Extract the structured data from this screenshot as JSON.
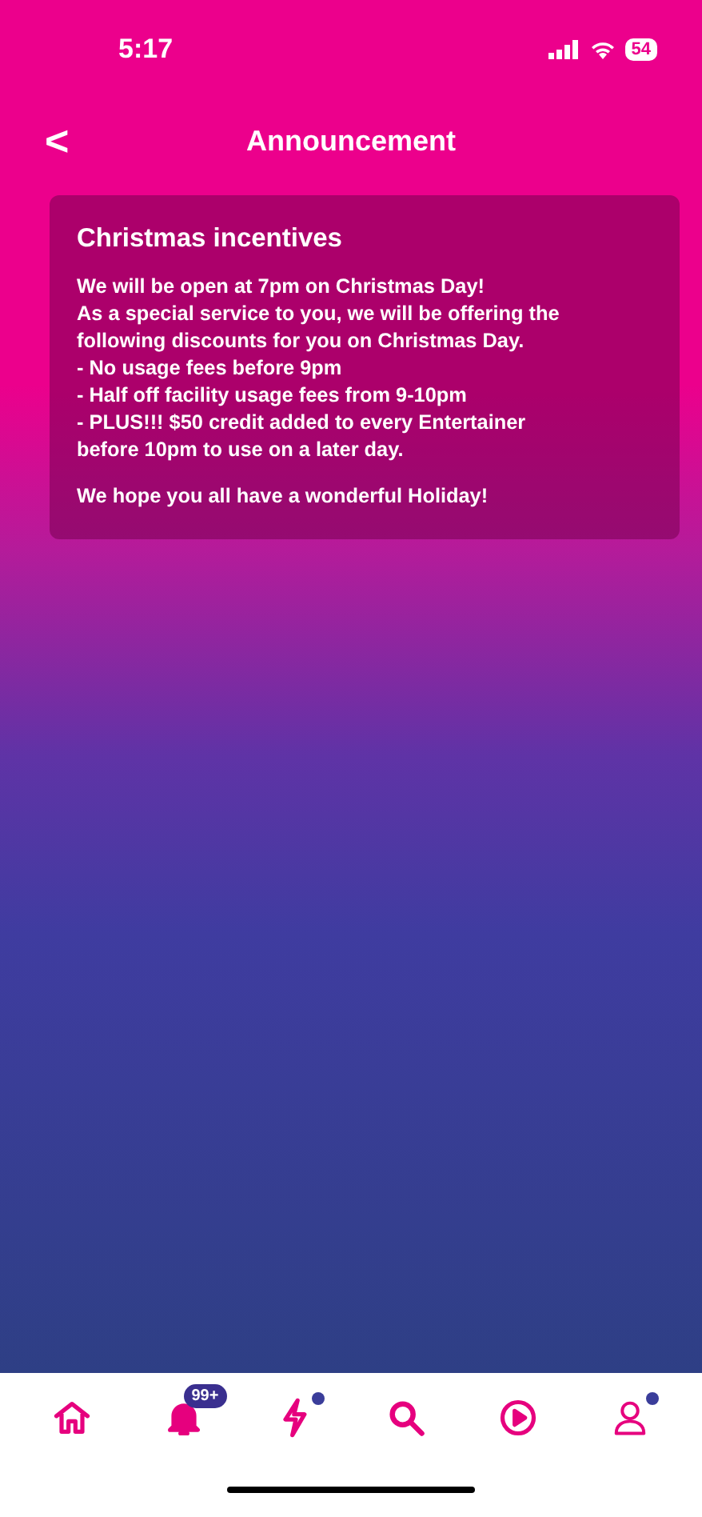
{
  "status_bar": {
    "time": "5:17",
    "battery": "54"
  },
  "header": {
    "back": "<",
    "title": "Announcement"
  },
  "announcement": {
    "title": "Christmas incentives",
    "paragraphs": [
      [
        "We will be open at 7pm on Christmas Day!",
        "As a special service to you, we will be offering the",
        "following discounts for you on Christmas Day.",
        "- No usage fees before 9pm",
        "- Half off facility usage fees from 9-10pm",
        "- PLUS!!! $50 credit added to every Entertainer",
        "before 10pm to use on a later day."
      ],
      [
        "We hope you all have a wonderful Holiday!"
      ]
    ]
  },
  "tab_bar": [
    {
      "kind": "home",
      "selected": false,
      "dot": false
    },
    {
      "kind": "bell",
      "selected": true,
      "badge": "99+",
      "dot": false
    },
    {
      "kind": "bolt",
      "selected": false,
      "dot": true
    },
    {
      "kind": "search",
      "selected": false,
      "dot": false
    },
    {
      "kind": "play",
      "selected": false,
      "dot": false
    },
    {
      "kind": "profile",
      "selected": false,
      "dot": true
    }
  ]
}
